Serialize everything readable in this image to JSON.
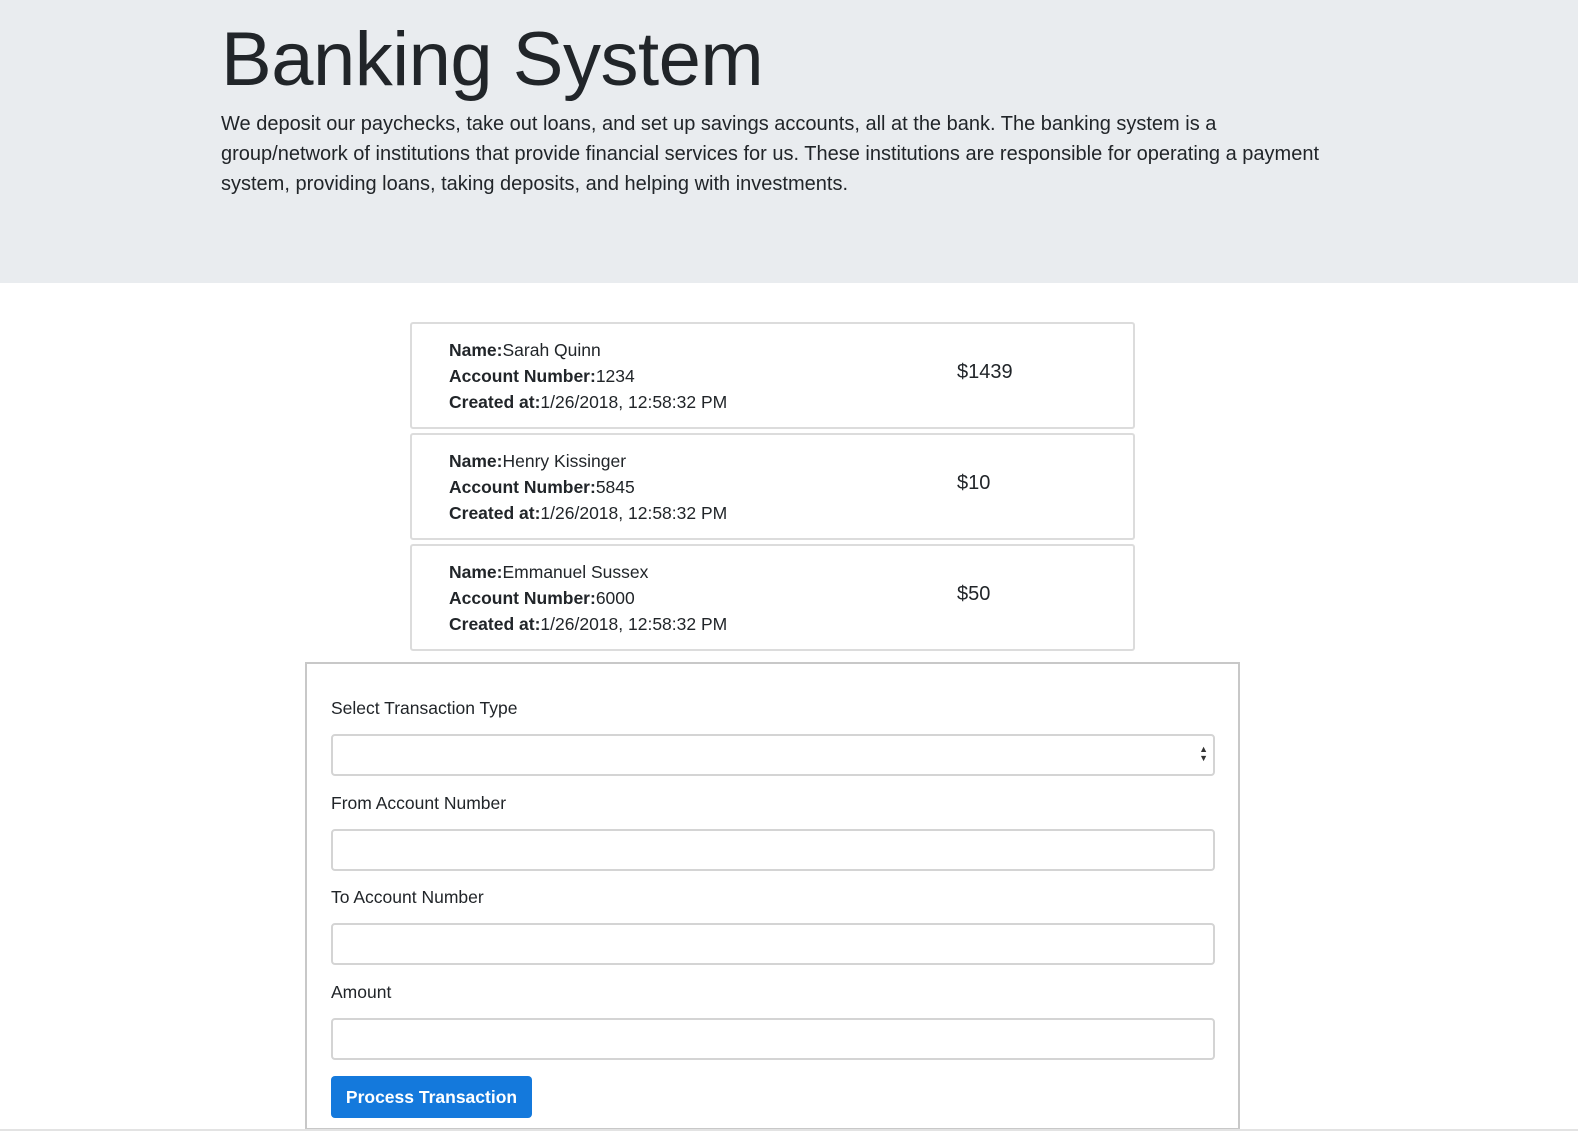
{
  "header": {
    "title": "Banking System",
    "lead": "We deposit our paychecks, take out loans, and set up savings accounts, all at the bank. The banking system is a group/network of institutions that provide financial services for us. These institutions are responsible for operating a payment system, providing loans, taking deposits, and helping with investments."
  },
  "labels": {
    "name": "Name:",
    "account_number": "Account Number:",
    "created_at": "Created at:"
  },
  "accounts": [
    {
      "name": "Sarah Quinn",
      "account_number": "1234",
      "created_at": "1/26/2018, 12:58:32 PM",
      "balance": "$1439"
    },
    {
      "name": "Henry Kissinger",
      "account_number": "5845",
      "created_at": "1/26/2018, 12:58:32 PM",
      "balance": "$10"
    },
    {
      "name": "Emmanuel Sussex",
      "account_number": "6000",
      "created_at": "1/26/2018, 12:58:32 PM",
      "balance": "$50"
    }
  ],
  "form": {
    "transaction_type_label": "Select Transaction Type",
    "transaction_type_value": "",
    "from_account_label": "From Account Number",
    "from_account_value": "",
    "to_account_label": "To Account Number",
    "to_account_value": "",
    "amount_label": "Amount",
    "amount_value": "",
    "submit_label": "Process Transaction"
  },
  "colors": {
    "jumbotron_bg": "#e9ecef",
    "primary": "#1479dc"
  }
}
